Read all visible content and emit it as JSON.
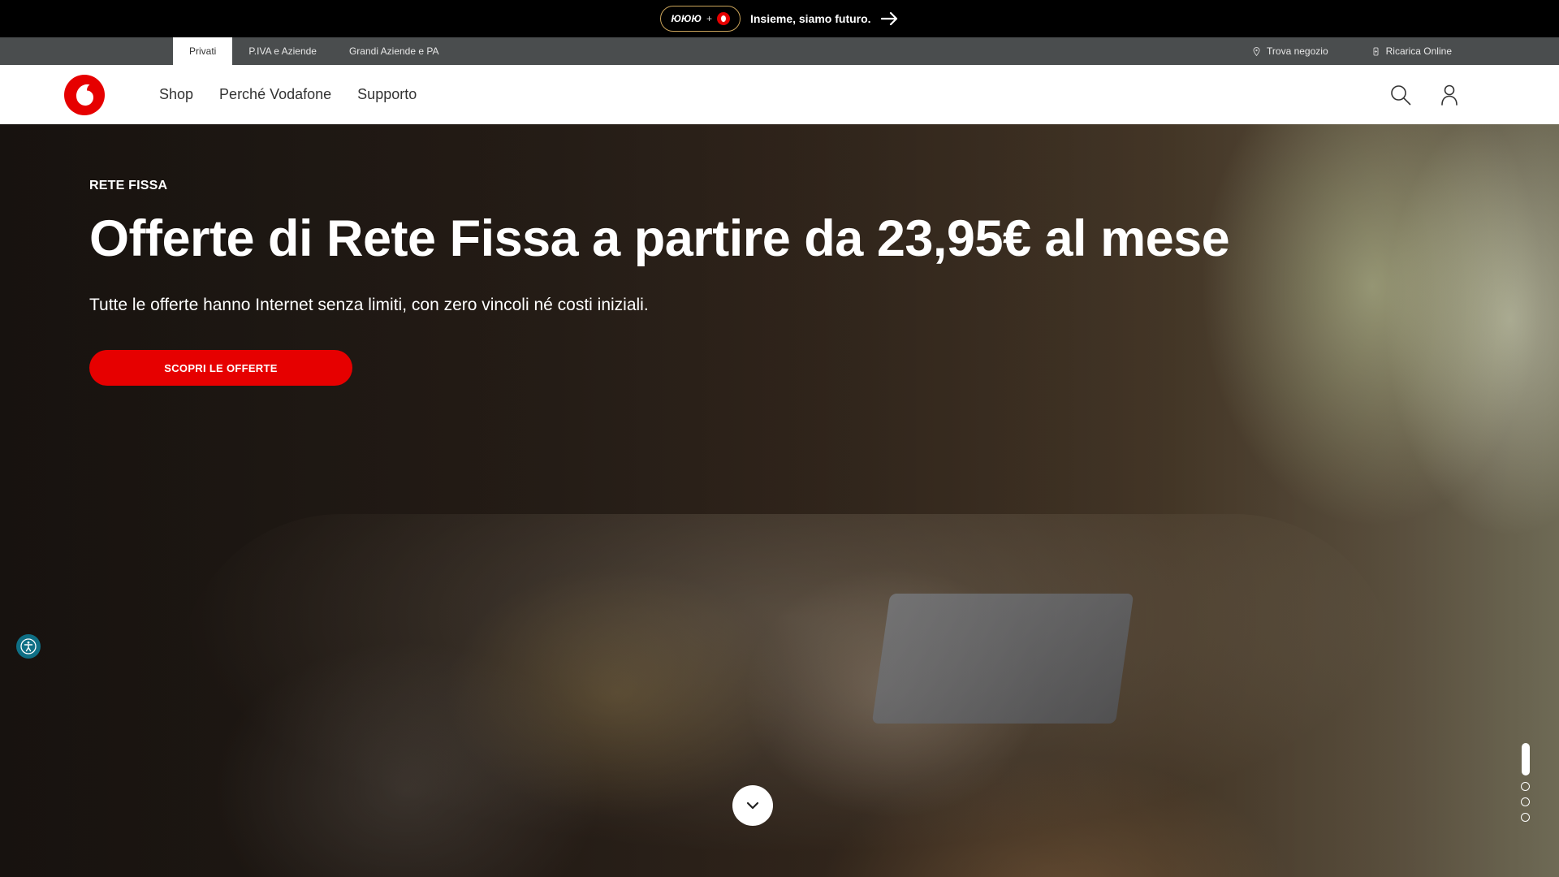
{
  "announcement": {
    "text": "Insieme, siamo futuro.",
    "partner_mark": "ЮЮЮ",
    "plus": "+"
  },
  "utility": {
    "segments": [
      "Privati",
      "P.IVA e Aziende",
      "Grandi Aziende e PA"
    ],
    "active_segment": "Privati",
    "links": [
      {
        "label": "Trova negozio",
        "icon": "location-pin-icon"
      },
      {
        "label": "Ricarica Online",
        "icon": "mobile-topup-icon"
      }
    ]
  },
  "nav": {
    "menu": [
      "Shop",
      "Perché Vodafone",
      "Supporto"
    ]
  },
  "hero": {
    "eyebrow": "RETE FISSA",
    "headline": "Offerte di Rete Fissa a partire da 23,95€ al mese",
    "subtitle": "Tutte le offerte hanno Internet senza limiti, con zero vincoli né costi iniziali.",
    "cta": "SCOPRI LE OFFERTE",
    "carousel": {
      "slides": 4,
      "active": 1
    }
  },
  "colors": {
    "brand_red": "#e60000",
    "utility_bar": "#4a4d4e",
    "accessibility_teal": "#0f6f85",
    "announce_border": "#c9a35a"
  }
}
